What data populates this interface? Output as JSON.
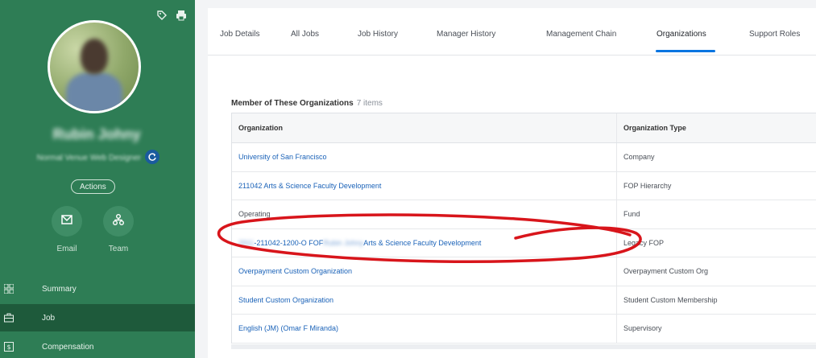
{
  "worker": {
    "name": "Rubin Johny",
    "title": "Normal Venue Web Designer"
  },
  "sidebar": {
    "actions_label": "Actions",
    "email_label": "Email",
    "team_label": "Team",
    "nav": [
      {
        "label": "Summary",
        "icon": "summary-grid-icon",
        "active": false
      },
      {
        "label": "Job",
        "icon": "briefcase-icon",
        "active": true
      },
      {
        "label": "Compensation",
        "icon": "compensation-icon",
        "active": false
      }
    ]
  },
  "tabs": [
    {
      "label": "Job Details",
      "active": false
    },
    {
      "label": "All Jobs",
      "active": false
    },
    {
      "label": "Job History",
      "active": false
    },
    {
      "label": "Manager History",
      "active": false
    },
    {
      "label": "Management Chain",
      "active": false
    },
    {
      "label": "Organizations",
      "active": true
    },
    {
      "label": "Support Roles",
      "active": false
    }
  ],
  "section": {
    "title": "Member of These Organizations",
    "count": "7 items"
  },
  "table": {
    "columns": [
      "Organization",
      "Organization Type"
    ],
    "rows": [
      {
        "org": "University of San Francisco",
        "type": "Company",
        "link": true
      },
      {
        "org": "211042 Arts & Science Faculty Development",
        "type": "FOP Hierarchy",
        "link": true
      },
      {
        "org": "Operating",
        "type": "Fund",
        "link": false
      },
      {
        "org_prefix": "2911",
        "org_mid": "-211042-1200-O FOF ",
        "org_blur": "Rubin Johny",
        "org_suffix": " Arts & Science Faculty Development",
        "type": "Legacy FOP",
        "link": true,
        "highlighted": true
      },
      {
        "org": "Overpayment Custom Organization",
        "type": "Overpayment Custom Org",
        "link": true
      },
      {
        "org": "Student Custom Organization",
        "type": "Student Custom Membership",
        "link": true
      },
      {
        "org": "English (JM) (Omar F Miranda)",
        "type": "Supervisory",
        "link": true
      }
    ]
  },
  "colors": {
    "sidebar": "#2e7d55",
    "sidebar_active": "#1e5a3b",
    "accent": "#0875e1",
    "link": "#1a62b8",
    "annotation": "#d8151b"
  }
}
